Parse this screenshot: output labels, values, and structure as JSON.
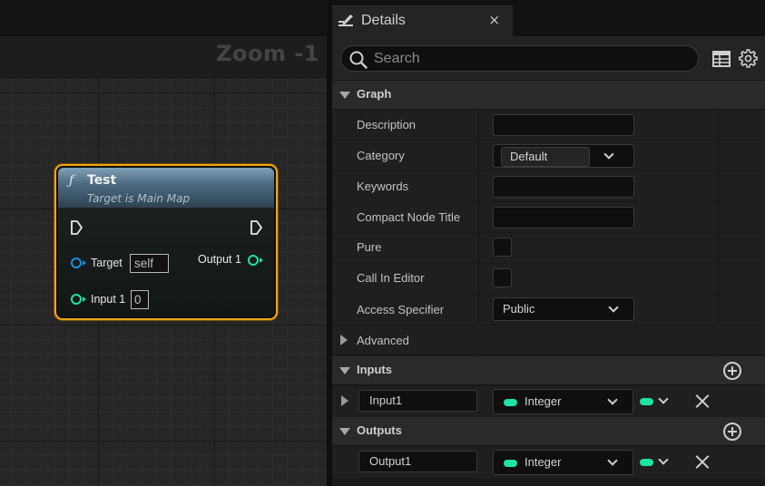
{
  "graph": {
    "zoom_label": "Zoom -1",
    "node": {
      "icon": "function-icon",
      "title": "Test",
      "subtitle": "Target is Main Map",
      "pins": {
        "target_label": "Target",
        "target_value": "self",
        "input_label": "Input 1",
        "input_value": "0",
        "output_label": "Output 1"
      },
      "colors": {
        "border": "#f0a314",
        "object_pin": "#1a8fe0",
        "integer_pin": "#1fe3a6",
        "exec_pin": "#e8e8e8"
      }
    }
  },
  "details": {
    "tab_title": "Details",
    "tab_close": "×",
    "search": {
      "placeholder": "Search"
    },
    "sections": {
      "graph": "Graph",
      "advanced": "Advanced",
      "inputs": "Inputs",
      "outputs": "Outputs"
    },
    "properties": {
      "description": {
        "label": "Description",
        "value": ""
      },
      "category": {
        "label": "Category",
        "value": "Default"
      },
      "keywords": {
        "label": "Keywords",
        "value": ""
      },
      "compact_node_title": {
        "label": "Compact Node Title",
        "value": ""
      },
      "pure": {
        "label": "Pure",
        "checked": false
      },
      "call_in_editor": {
        "label": "Call In Editor",
        "checked": false
      },
      "access_specifier": {
        "label": "Access Specifier",
        "value": "Public"
      }
    },
    "inputs": [
      {
        "name": "Input1",
        "type": "Integer"
      }
    ],
    "outputs": [
      {
        "name": "Output1",
        "type": "Integer"
      }
    ],
    "colors": {
      "integer_type": "#1fe3a6"
    }
  }
}
